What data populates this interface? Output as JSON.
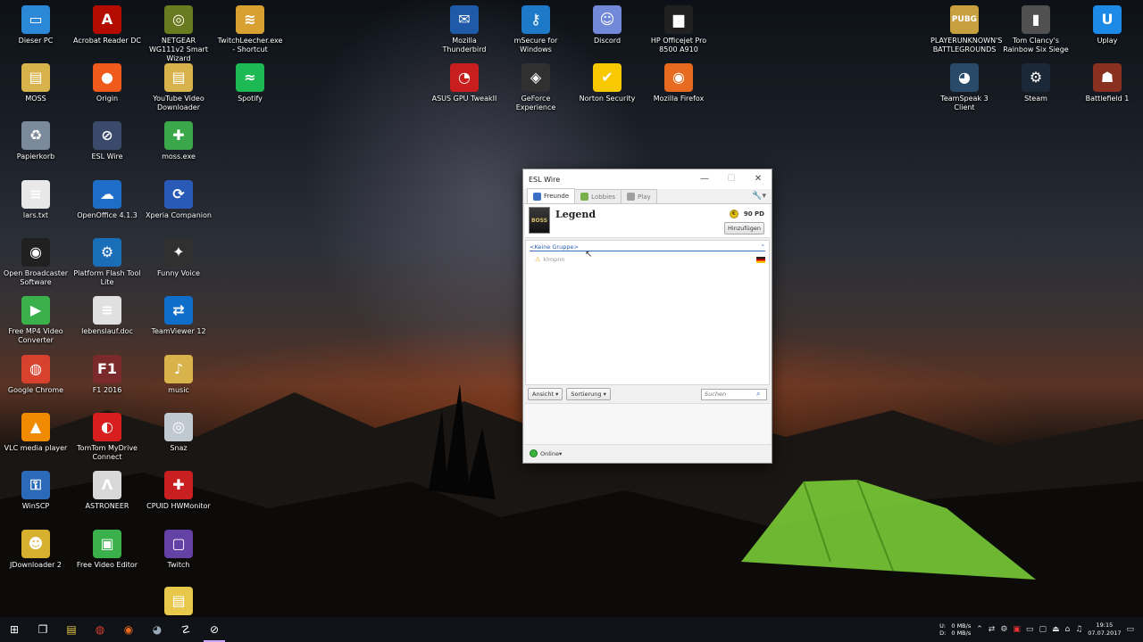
{
  "desktop": {
    "icons": [
      {
        "label": "Dieser PC",
        "glyph": "▭",
        "color": "#2b88d8"
      },
      {
        "label": "Acrobat Reader DC",
        "glyph": "A",
        "color": "#b30b00"
      },
      {
        "label": "NETGEAR WG111v2 Smart Wizard",
        "glyph": "◎",
        "color": "#6a7a1e"
      },
      {
        "label": "TwitchLeecher.exe - Shortcut",
        "glyph": "≋",
        "color": "#d8a030"
      },
      {
        "label": "MOSS",
        "glyph": "▤",
        "color": "#d8b24a"
      },
      {
        "label": "Origin",
        "glyph": "●",
        "color": "#f05a1a"
      },
      {
        "label": "YouTube Video Downloader",
        "glyph": "▤",
        "color": "#d8b24a"
      },
      {
        "label": "Spotify",
        "glyph": "≈",
        "color": "#1db954"
      },
      {
        "label": "Papierkorb",
        "glyph": "♻",
        "color": "#7a8a9a"
      },
      {
        "label": "ESL Wire",
        "glyph": "⊘",
        "color": "#3b4a6b"
      },
      {
        "label": "moss.exe",
        "glyph": "✚",
        "color": "#3aa84a"
      },
      {
        "label": "lars.txt",
        "glyph": "≡",
        "color": "#e8e8e8"
      },
      {
        "label": "OpenOffice 4.1.3",
        "glyph": "☁",
        "color": "#1e6ec8"
      },
      {
        "label": "Xperia Companion",
        "glyph": "⟳",
        "color": "#2a5ab8"
      },
      {
        "label": "Open Broadcaster Software",
        "glyph": "◉",
        "color": "#202020"
      },
      {
        "label": "Platform Flash Tool Lite",
        "glyph": "⚙",
        "color": "#1a6eb8"
      },
      {
        "label": "Funny Voice",
        "glyph": "✦",
        "color": "#303030"
      },
      {
        "label": "Free MP4 Video Converter",
        "glyph": "▶",
        "color": "#3ab04a"
      },
      {
        "label": "lebenslauf.doc",
        "glyph": "≡",
        "color": "#e0e0e0"
      },
      {
        "label": "TeamViewer 12",
        "glyph": "⇄",
        "color": "#0e6ec8"
      },
      {
        "label": "Google Chrome",
        "glyph": "◍",
        "color": "#d9412f"
      },
      {
        "label": "F1 2016",
        "glyph": "F1",
        "color": "#7a2a2a"
      },
      {
        "label": "music",
        "glyph": "♪",
        "color": "#d8b24a"
      },
      {
        "label": "VLC media player",
        "glyph": "▲",
        "color": "#f08a00"
      },
      {
        "label": "TomTom MyDrive Connect",
        "glyph": "◐",
        "color": "#d81e1e"
      },
      {
        "label": "Snaz",
        "glyph": "◎",
        "color": "#c0c8d0"
      },
      {
        "label": "WinSCP",
        "glyph": "⚿",
        "color": "#2a6ab8"
      },
      {
        "label": "ASTRONEER",
        "glyph": "Λ",
        "color": "#d8d8d8"
      },
      {
        "label": "CPUID HWMonitor",
        "glyph": "✚",
        "color": "#c82020"
      },
      {
        "label": "JDownloader 2",
        "glyph": "☻",
        "color": "#d8b030"
      },
      {
        "label": "Free Video Editor",
        "glyph": "▣",
        "color": "#3ab04a"
      },
      {
        "label": "Twitch",
        "glyph": "▢",
        "color": "#6441a4"
      },
      {
        "label": "Mozilla Thunderbird",
        "glyph": "✉",
        "color": "#1e5aa8"
      },
      {
        "label": "mSecure for Windows",
        "glyph": "⚷",
        "color": "#1e7ac8"
      },
      {
        "label": "Discord",
        "glyph": "☺",
        "color": "#7289da"
      },
      {
        "label": "HP Officejet Pro 8500 A910",
        "glyph": "▆",
        "color": "#202020"
      },
      {
        "label": "ASUS GPU TweakII",
        "glyph": "◔",
        "color": "#c81e1e"
      },
      {
        "label": "GeForce Experience",
        "glyph": "◈",
        "color": "#303030"
      },
      {
        "label": "Norton Security",
        "glyph": "✔",
        "color": "#f8c800"
      },
      {
        "label": "Mozilla Firefox",
        "glyph": "◉",
        "color": "#e86a1e"
      },
      {
        "label": "PLAYERUNKNOWN'S BATTLEGROUNDS",
        "glyph": "PUBG",
        "color": "#c8a040"
      },
      {
        "label": "Tom Clancy's Rainbow Six Siege",
        "glyph": "▮",
        "color": "#505050"
      },
      {
        "label": "Uplay",
        "glyph": "U",
        "color": "#1e8ae8"
      },
      {
        "label": "TeamSpeak 3 Client",
        "glyph": "◕",
        "color": "#2a4a6a"
      },
      {
        "label": "Steam",
        "glyph": "⚙",
        "color": "#1b2838"
      },
      {
        "label": "Battlefield 1",
        "glyph": "☗",
        "color": "#8a3020"
      },
      {
        "label": "",
        "glyph": "▤",
        "color": "#e8c84a"
      }
    ]
  },
  "window": {
    "title": "ESL Wire",
    "tabs": [
      {
        "label": "Freunde",
        "active": true,
        "color": "#3a70c8"
      },
      {
        "label": "Lobbies",
        "active": false,
        "color": "#7ab04a"
      },
      {
        "label": "Play",
        "active": false,
        "color": "#a0a0a0"
      }
    ],
    "profile": {
      "name": "Legend",
      "points": "90 PD",
      "add_label": "Hinzufügen",
      "avatar_text": "BOSS"
    },
    "group": {
      "name": "<Keine Gruppe>"
    },
    "friends": [
      {
        "name": "klmpnn"
      }
    ],
    "toolbar": {
      "view_label": "Ansicht",
      "sort_label": "Sortierung",
      "search_placeholder": "Suchen"
    },
    "status": {
      "label": "Online"
    }
  },
  "taskbar": {
    "net_up": "0 MB/s",
    "net_down": "0 MB/s",
    "drive_u": "U:",
    "drive_d": "D:",
    "time": "19:15",
    "date": "07.07.2017"
  }
}
